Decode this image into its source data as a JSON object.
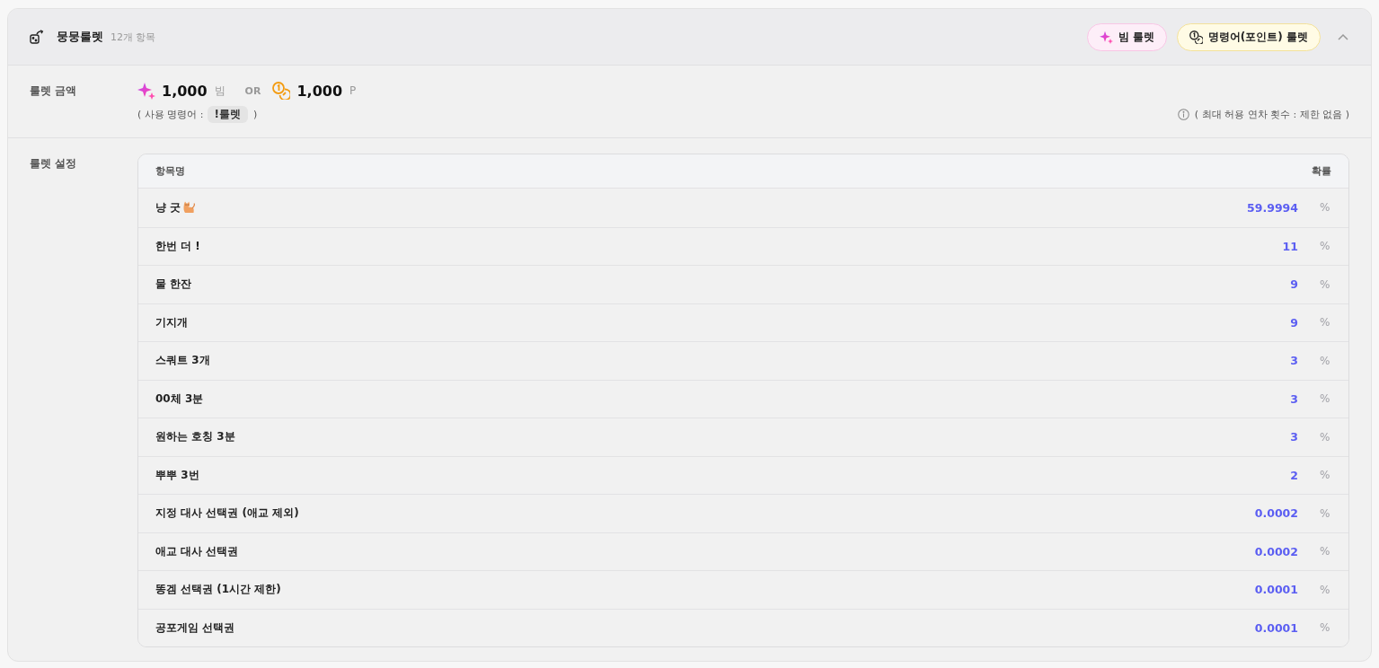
{
  "header": {
    "title": "뭉뭉룰렛",
    "count": "12개 항목",
    "buttons": [
      {
        "label": "빔 룰렛",
        "kind": "beam"
      },
      {
        "label": "명령어(포인트) 룰렛",
        "kind": "point"
      }
    ],
    "expanded": true
  },
  "amount": {
    "label": "룰렛 금액",
    "prices": [
      {
        "kind": "beam",
        "value": "1,000",
        "unit": "빔"
      },
      {
        "kind": "point",
        "value": "1,000",
        "unit": "P"
      }
    ],
    "separator": "OR",
    "command": {
      "prefix": "( 사용 명령어 :",
      "value": "!룰렛",
      "suffix": ")"
    },
    "limit_note": "( 최대 허용 연차 횟수 : 제한 없음 )"
  },
  "settings": {
    "label": "룰렛 설정",
    "table": {
      "columns": [
        "항목명",
        "확률"
      ],
      "rows": [
        {
          "name": "냥 굿",
          "trailing_icon": true,
          "value": "59.9994",
          "unit": "%"
        },
        {
          "name": "한번 더 !",
          "trailing_icon": false,
          "value": "11",
          "unit": "%"
        },
        {
          "name": "물 한잔",
          "trailing_icon": false,
          "value": "9",
          "unit": "%"
        },
        {
          "name": "기지개",
          "trailing_icon": false,
          "value": "9",
          "unit": "%"
        },
        {
          "name": "스쿼트 3개",
          "trailing_icon": false,
          "value": "3",
          "unit": "%"
        },
        {
          "name": "00체 3분",
          "trailing_icon": false,
          "value": "3",
          "unit": "%"
        },
        {
          "name": "원하는 호칭 3분",
          "trailing_icon": false,
          "value": "3",
          "unit": "%"
        },
        {
          "name": "뿌뿌 3번",
          "trailing_icon": false,
          "value": "2",
          "unit": "%"
        },
        {
          "name": "지정 대사 선택권 (애교 제외)",
          "trailing_icon": false,
          "value": "0.0002",
          "unit": "%"
        },
        {
          "name": "애교 대사 선택권",
          "trailing_icon": false,
          "value": "0.0002",
          "unit": "%"
        },
        {
          "name": "똥겜 선택권 (1시간 제한)",
          "trailing_icon": false,
          "value": "0.0001",
          "unit": "%"
        },
        {
          "name": "공포게임 선택권",
          "trailing_icon": false,
          "value": "0.0001",
          "unit": "%"
        }
      ]
    }
  }
}
